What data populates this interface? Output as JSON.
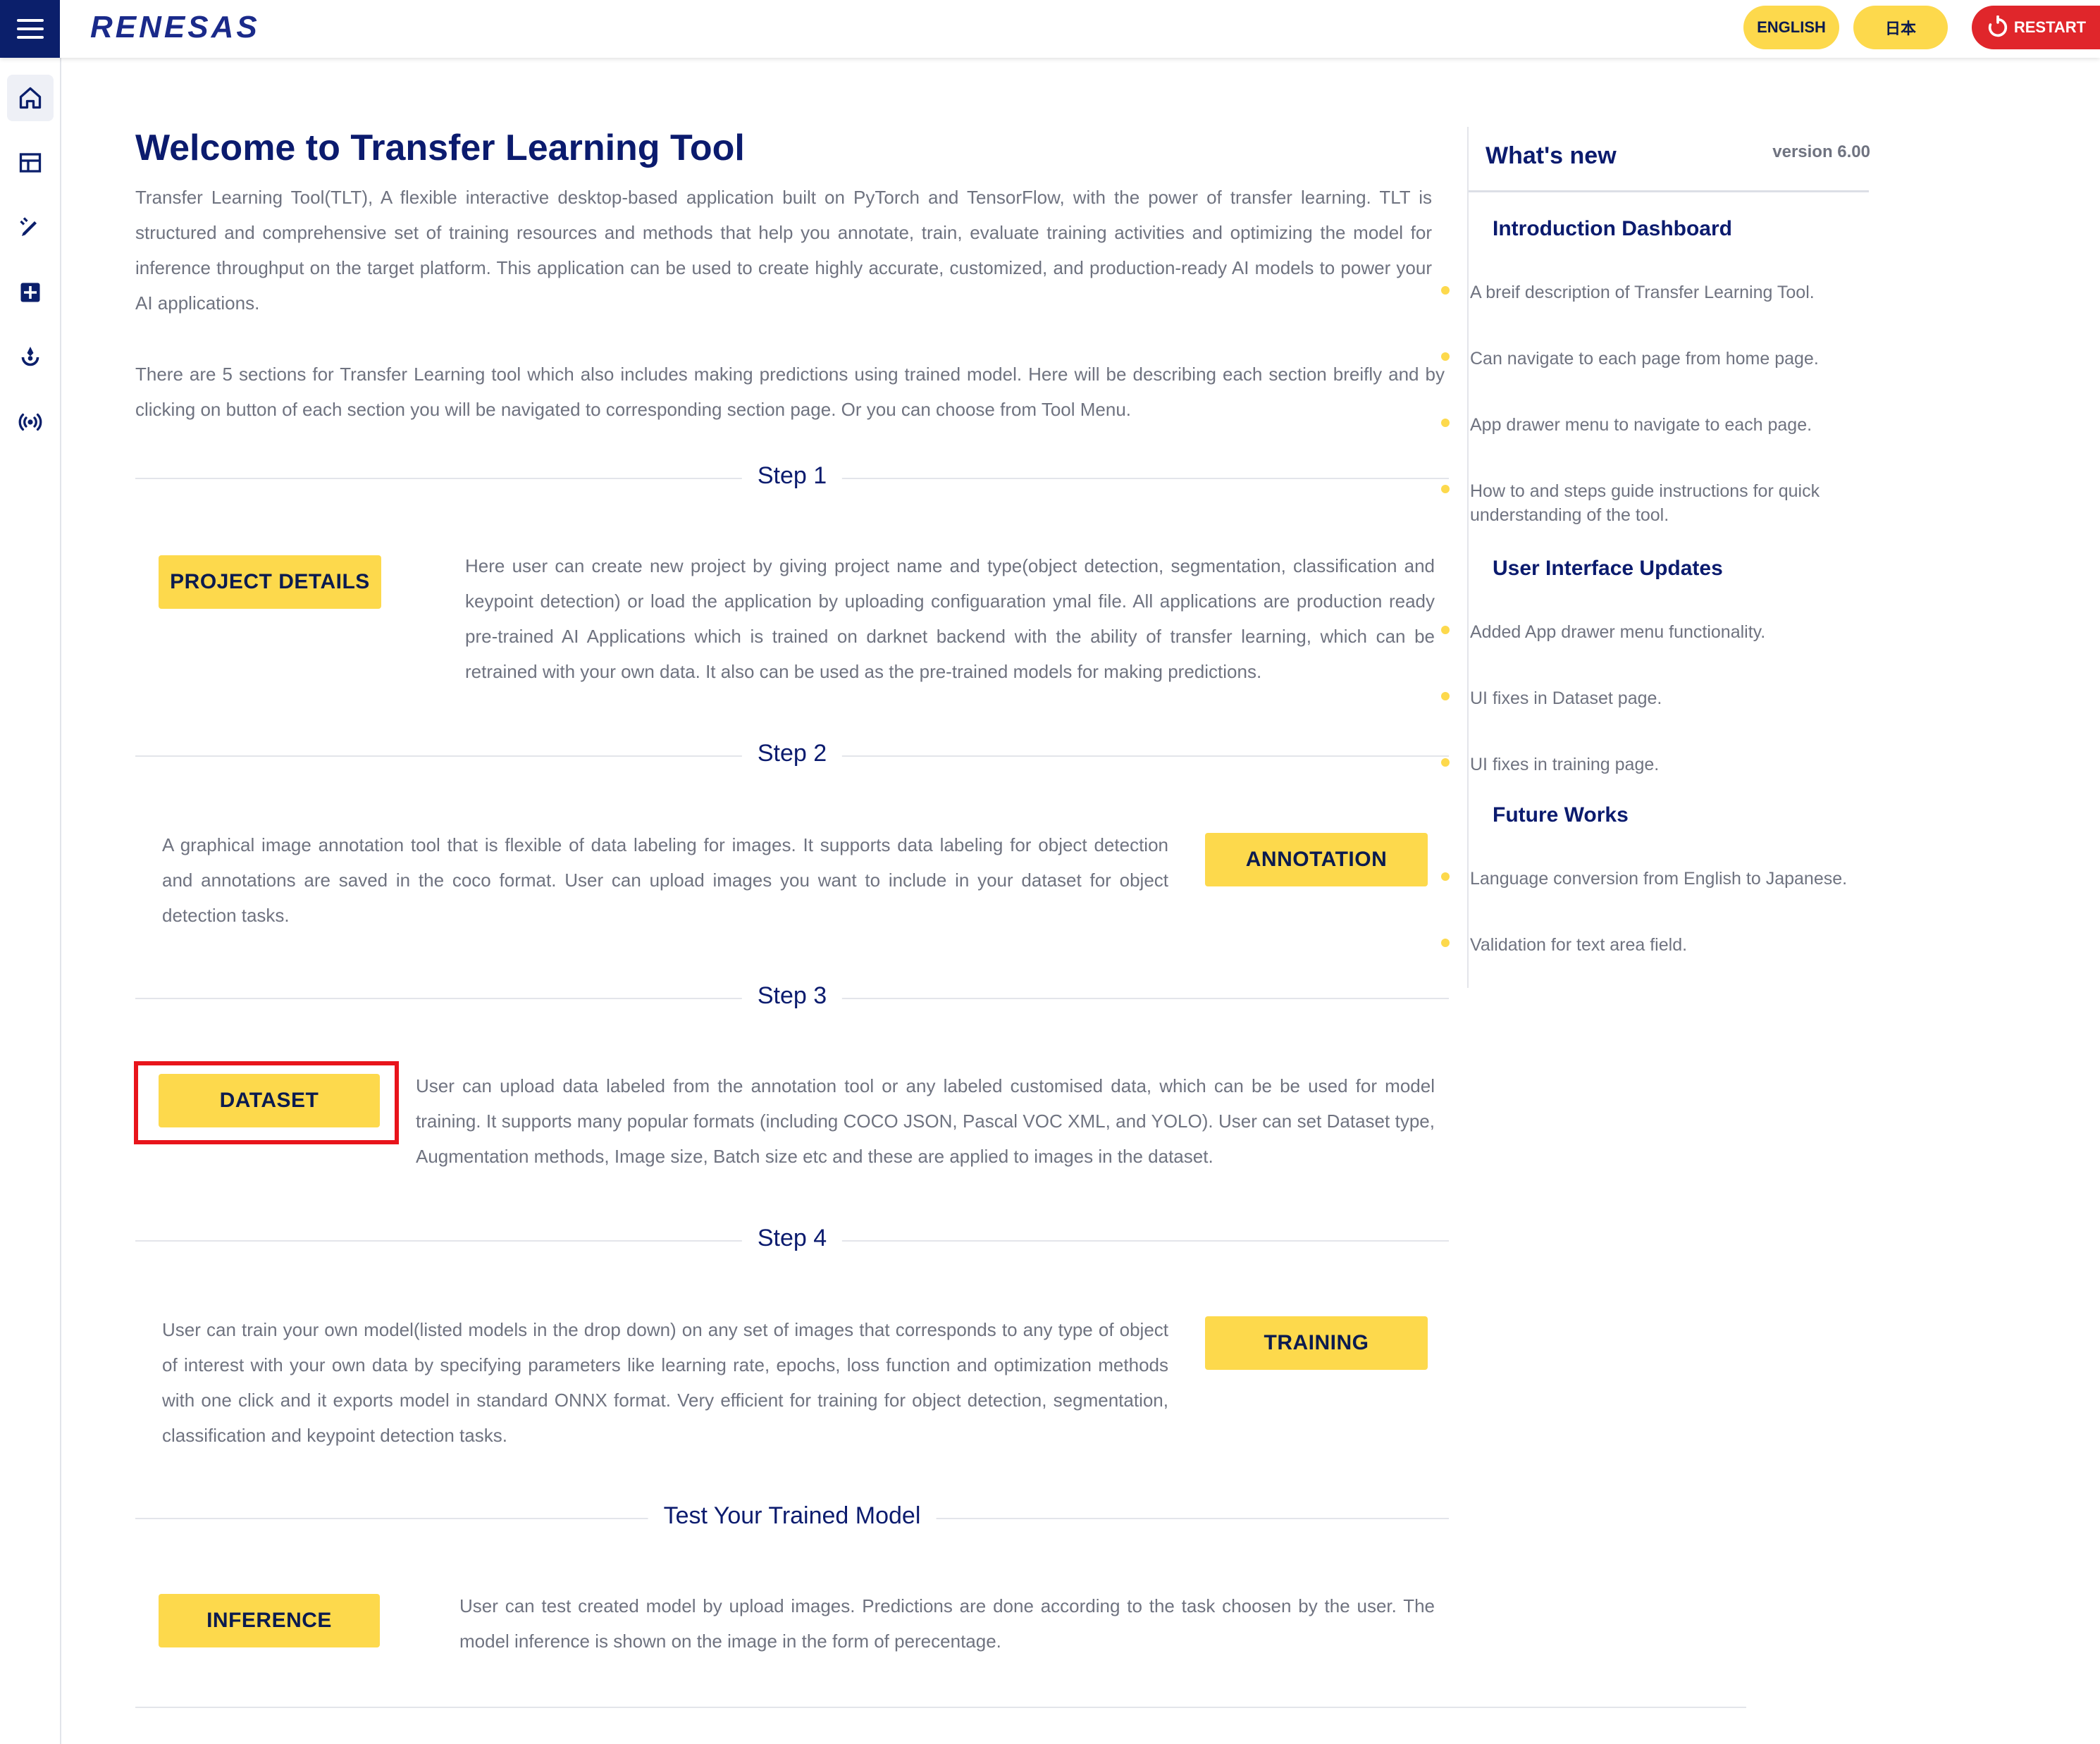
{
  "topbar": {
    "logo_text": "RENESAS",
    "english_label": "ENGLISH",
    "japanese_label": "日本",
    "restart_label": "RESTART"
  },
  "sidebar": {
    "items": [
      "home-icon",
      "table-icon",
      "annotate-icon",
      "grid-icon",
      "deploy-icon",
      "signal-icon"
    ]
  },
  "main": {
    "title": "Welcome to Transfer Learning Tool",
    "intro1": "Transfer Learning Tool(TLT), A flexible interactive desktop-based application built on PyTorch and TensorFlow, with the power of transfer learning. TLT is structured and comprehensive set of training resources and methods that help you annotate, train, evaluate training activities and optimizing the model for inference throughput on the target platform. This application can be used to create highly accurate, customized, and production-ready AI models to power your AI applications.",
    "intro2": "There are 5 sections for Transfer Learning tool which also includes making predictions using trained model. Here will be describing each section breifly and by clicking on button of each section you will be navigated to corresponding section page. Or you can choose from Tool Menu.",
    "steps": [
      {
        "label": "Step 1",
        "button": "PROJECT DETAILS",
        "text": "Here user can create new project by giving project name and type(object detection, segmentation, classification and keypoint detection) or load the application by uploading configuaration ymal file. All applications are production ready pre-trained AI Applications which is trained on darknet backend with the ability of transfer learning, which can be retrained with your own data. It also can be used as the pre-trained models for making predictions."
      },
      {
        "label": "Step 2",
        "button": "ANNOTATION",
        "text": "A graphical image annotation tool that is flexible of data labeling for images. It supports data labeling for object detection and annotations are saved in the coco format. User can upload images you want to include in your dataset for object detection tasks."
      },
      {
        "label": "Step 3",
        "button": "DATASET",
        "text": "User can upload data labeled from the annotation tool or any labeled customised data, which can be be used for model training. It supports many popular formats (including COCO JSON, Pascal VOC XML, and YOLO). User can set Dataset type, Augmentation methods, Image size, Batch size etc and these are applied to images in the dataset."
      },
      {
        "label": "Step 4",
        "button": "TRAINING",
        "text": "User can train your own model(listed models in the drop down) on any set of images that corresponds to any type of object of interest with your own data by specifying parameters like learning rate, epochs, loss function and optimization methods with one click and it exports model in standard ONNX format. Very efficient for training for object detection, segmentation, classification and keypoint detection tasks."
      },
      {
        "label": "Test Your Trained Model",
        "button": "INFERENCE",
        "text": "User can test created model by upload images. Predictions are done according to the task choosen by the user. The model inference is shown on the image in the form of perecentage."
      }
    ]
  },
  "whats_new": {
    "title": "What's new",
    "version": "version 6.00",
    "sections": [
      {
        "heading": "Introduction Dashboard",
        "items": [
          "A breif description of Transfer Learning Tool.",
          "Can navigate to each page from home page.",
          "App drawer menu to navigate to each page.",
          "How to and steps guide instructions for quick understanding of the tool."
        ]
      },
      {
        "heading": "User Interface Updates",
        "items": [
          "Added App drawer menu functionality.",
          "UI fixes in Dataset page.",
          "UI fixes in training page."
        ]
      },
      {
        "heading": "Future Works",
        "items": [
          "Language conversion from English to Japanese.",
          "Validation for text area field."
        ]
      }
    ]
  },
  "colors": {
    "accent_yellow": "#fdd94c",
    "navy": "#0b1b6e",
    "restart_red": "#e0262b",
    "highlight_red": "#e8141b"
  }
}
